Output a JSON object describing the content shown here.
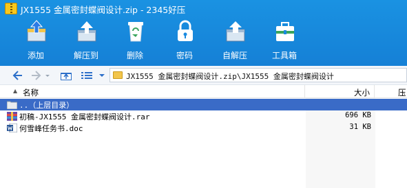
{
  "window": {
    "title": "JX1555 金属密封蝶阀设计.zip - 2345好压"
  },
  "toolbar": {
    "buttons": [
      {
        "label": "添加",
        "icon": "add-archive-icon"
      },
      {
        "label": "解压到",
        "icon": "extract-to-icon"
      },
      {
        "label": "删除",
        "icon": "delete-icon"
      },
      {
        "label": "密码",
        "icon": "lock-icon"
      },
      {
        "label": "自解压",
        "icon": "self-extract-icon"
      },
      {
        "label": "工具箱",
        "icon": "toolbox-icon"
      }
    ]
  },
  "addressbar": {
    "path": "JX1555 金属密封蝶阀设计.zip\\JX1555 金属密封蝶阀设计"
  },
  "columns": {
    "name": "名称",
    "size": "大小",
    "packed": "压"
  },
  "files": [
    {
      "name": "..（上层目录）",
      "size": "",
      "icon": "folder-up-icon",
      "selected": true
    },
    {
      "name": "初稿-JX1555 金属密封蝶阀设计.rar",
      "size": "696 KB",
      "icon": "rar-archive-icon",
      "selected": false
    },
    {
      "name": "何雪峰任务书.doc",
      "size": "31 KB",
      "icon": "word-doc-icon",
      "selected": false
    }
  ],
  "colors": {
    "toolbar_bg": "#1a8ae0",
    "selection": "#3a6bc7",
    "address_bg": "#f3f6fa"
  }
}
